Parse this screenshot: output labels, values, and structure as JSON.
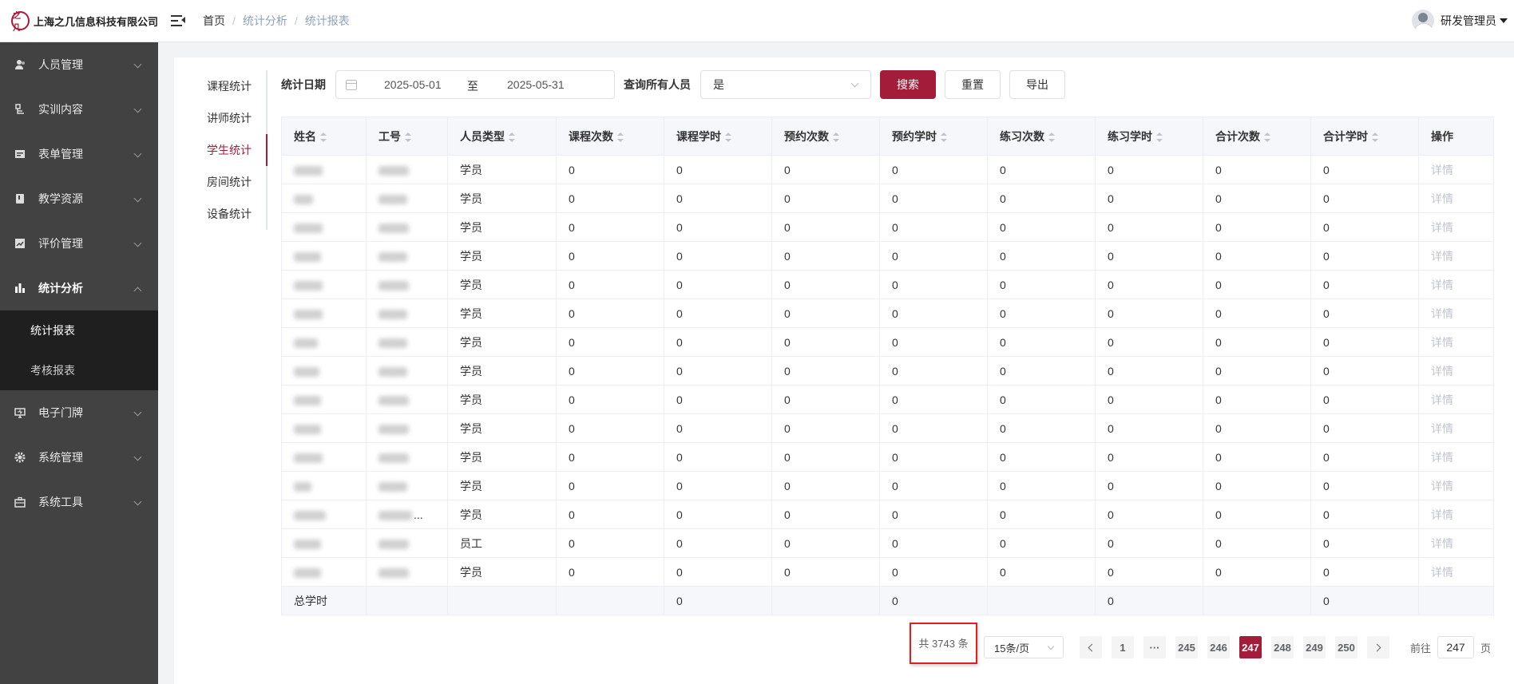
{
  "header": {
    "company": "上海之几信息科技有限公司",
    "logo_mark": "之几",
    "breadcrumb": [
      "首页",
      "统计分析",
      "统计报表"
    ],
    "user_name": "研发管理员"
  },
  "sidebar": {
    "items": [
      {
        "label": "人员管理",
        "icon": "user-icon"
      },
      {
        "label": "实训内容",
        "icon": "document-icon"
      },
      {
        "label": "表单管理",
        "icon": "form-icon"
      },
      {
        "label": "教学资源",
        "icon": "book-icon"
      },
      {
        "label": "评价管理",
        "icon": "chart-icon"
      },
      {
        "label": "统计分析",
        "icon": "bar-chart-icon",
        "open": true
      },
      {
        "label": "电子门牌",
        "icon": "monitor-icon"
      },
      {
        "label": "系统管理",
        "icon": "gear-icon"
      },
      {
        "label": "系统工具",
        "icon": "toolbox-icon"
      }
    ],
    "submenu": [
      "统计报表",
      "考核报表"
    ]
  },
  "stat_tabs": [
    "课程统计",
    "讲师统计",
    "学生统计",
    "房间统计",
    "设备统计"
  ],
  "filter": {
    "date_label": "统计日期",
    "date_start": "2025-05-01",
    "date_sep": "至",
    "date_end": "2025-05-31",
    "all_label": "查询所有人员",
    "all_value": "是",
    "search_btn": "搜索",
    "reset_btn": "重置",
    "export_btn": "导出"
  },
  "table": {
    "columns": [
      "姓名",
      "工号",
      "人员类型",
      "课程次数",
      "课程学时",
      "预约次数",
      "预约学时",
      "练习次数",
      "练习学时",
      "合计次数",
      "合计学时",
      "操作"
    ],
    "rows": [
      {
        "type": "学员",
        "values": [
          "0",
          "0",
          "0",
          "0",
          "0",
          "0",
          "0",
          "0"
        ],
        "op": "详情"
      },
      {
        "type": "学员",
        "values": [
          "0",
          "0",
          "0",
          "0",
          "0",
          "0",
          "0",
          "0"
        ],
        "op": "详情"
      },
      {
        "type": "学员",
        "values": [
          "0",
          "0",
          "0",
          "0",
          "0",
          "0",
          "0",
          "0"
        ],
        "op": "详情"
      },
      {
        "type": "学员",
        "values": [
          "0",
          "0",
          "0",
          "0",
          "0",
          "0",
          "0",
          "0"
        ],
        "op": "详情"
      },
      {
        "type": "学员",
        "values": [
          "0",
          "0",
          "0",
          "0",
          "0",
          "0",
          "0",
          "0"
        ],
        "op": "详情"
      },
      {
        "type": "学员",
        "values": [
          "0",
          "0",
          "0",
          "0",
          "0",
          "0",
          "0",
          "0"
        ],
        "op": "详情"
      },
      {
        "type": "学员",
        "values": [
          "0",
          "0",
          "0",
          "0",
          "0",
          "0",
          "0",
          "0"
        ],
        "op": "详情"
      },
      {
        "type": "学员",
        "values": [
          "0",
          "0",
          "0",
          "0",
          "0",
          "0",
          "0",
          "0"
        ],
        "op": "详情"
      },
      {
        "type": "学员",
        "values": [
          "0",
          "0",
          "0",
          "0",
          "0",
          "0",
          "0",
          "0"
        ],
        "op": "详情"
      },
      {
        "type": "学员",
        "values": [
          "0",
          "0",
          "0",
          "0",
          "0",
          "0",
          "0",
          "0"
        ],
        "op": "详情"
      },
      {
        "type": "学员",
        "values": [
          "0",
          "0",
          "0",
          "0",
          "0",
          "0",
          "0",
          "0"
        ],
        "op": "详情"
      },
      {
        "type": "学员",
        "values": [
          "0",
          "0",
          "0",
          "0",
          "0",
          "0",
          "0",
          "0"
        ],
        "op": "详情"
      },
      {
        "type": "学员",
        "values": [
          "0",
          "0",
          "0",
          "0",
          "0",
          "0",
          "0",
          "0"
        ],
        "op": "详情",
        "id_ellipsis": "..."
      },
      {
        "type": "员工",
        "values": [
          "0",
          "0",
          "0",
          "0",
          "0",
          "0",
          "0",
          "0"
        ],
        "op": "详情"
      },
      {
        "type": "学员",
        "values": [
          "0",
          "0",
          "0",
          "0",
          "0",
          "0",
          "0",
          "0"
        ],
        "op": "详情"
      }
    ],
    "summary": {
      "label": "总学时",
      "course_hours": "0",
      "booking_hours": "0",
      "practice_hours": "0",
      "total_hours": "0"
    }
  },
  "pagination": {
    "total": "共 3743 条",
    "page_size": "15条/页",
    "pages": [
      "1",
      "···",
      "245",
      "246",
      "247",
      "248",
      "249",
      "250"
    ],
    "current": "247",
    "goto_label": "前往",
    "goto_value": "247",
    "goto_suffix": "页"
  }
}
